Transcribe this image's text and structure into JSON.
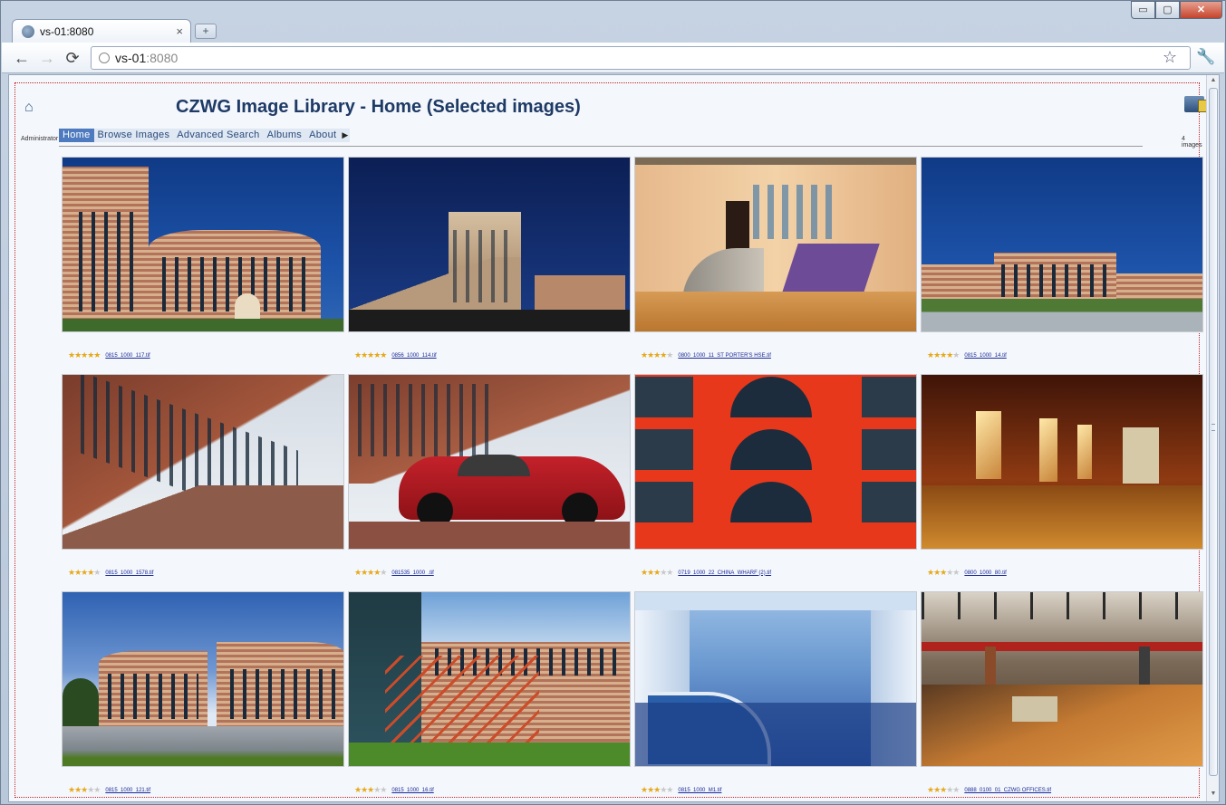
{
  "browser": {
    "tab_title": "vs-01:8080",
    "new_tab_label": "+",
    "address_host": "vs-01",
    "address_port": ":8080",
    "back_label": "←",
    "forward_label": "→",
    "reload_label": "⟳",
    "star_label": "☆",
    "wrench_label": "🔧",
    "min_label": "▭",
    "max_label": "▢",
    "close_label": "✕"
  },
  "page": {
    "title": "CZWG Image Library - Home (Selected images)",
    "admin_label": "Administrator",
    "image_count": "4 images",
    "home_icon": "home-icon",
    "cart_icon": "collection-icon"
  },
  "menu": {
    "items": [
      {
        "label": "Home",
        "active": true
      },
      {
        "label": "Browse Images",
        "active": false
      },
      {
        "label": "Advanced Search",
        "active": false
      },
      {
        "label": "Albums",
        "active": false
      },
      {
        "label": "About",
        "active": false
      }
    ],
    "more_arrow": "▶"
  },
  "images": [
    {
      "file": "0815_1000_117.tif",
      "rating": 5
    },
    {
      "file": "0856_1000_114.tif",
      "rating": 5
    },
    {
      "file": "0800_1000_11_ST PORTER'S HSE.tif",
      "rating": 4
    },
    {
      "file": "0815_1000_14.tif",
      "rating": 4
    },
    {
      "file": "0815_1000_1578.tif",
      "rating": 4
    },
    {
      "file": "081535_1000_.tif",
      "rating": 4
    },
    {
      "file": "0719_1000_22_CHINA_WHARF (2).tif",
      "rating": 3
    },
    {
      "file": "0800_1000_80.tif",
      "rating": 3
    },
    {
      "file": "0815_1000_121.tif",
      "rating": 3
    },
    {
      "file": "0815_1000_16.tif",
      "rating": 3
    },
    {
      "file": "0815_1000_M1.tif",
      "rating": 3
    },
    {
      "file": "0888_0100_01_CZWG OFFICES.tif",
      "rating": 3
    }
  ]
}
